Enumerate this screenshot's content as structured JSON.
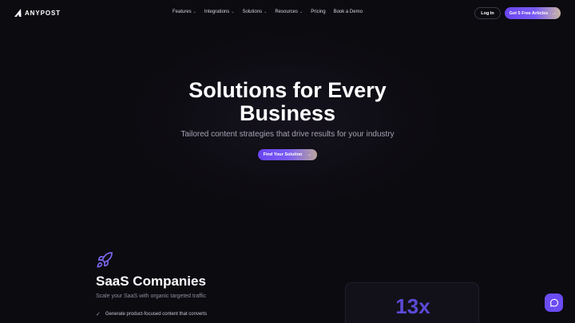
{
  "brand": {
    "name": "ANYPOST"
  },
  "nav": {
    "items": [
      {
        "label": "Features",
        "has_dropdown": true
      },
      {
        "label": "Integrations",
        "has_dropdown": true
      },
      {
        "label": "Solutions",
        "has_dropdown": true
      },
      {
        "label": "Resources",
        "has_dropdown": true
      },
      {
        "label": "Pricing",
        "has_dropdown": false
      },
      {
        "label": "Book a Demo",
        "has_dropdown": false
      }
    ],
    "login_label": "Log In",
    "cta_label": "Get 5 Free Articles",
    "cta_arrow": "→"
  },
  "hero": {
    "title_line1": "Solutions for Every",
    "title_line2": "Business",
    "subtitle": "Tailored content strategies that drive results for your industry",
    "button_label": "Find Your Solution",
    "button_arrow": "→"
  },
  "section": {
    "icon": "rocket-icon",
    "title": "SaaS Companies",
    "subtitle": "Scale your SaaS with organic targeted traffic",
    "bullets": [
      "Generate product-focused content that converts"
    ],
    "check_glyph": "✓"
  },
  "stat": {
    "value": "13x"
  },
  "colors": {
    "background": "#0c0b10",
    "accent": "#6a45f0",
    "stat_text": "#5b4ad6",
    "muted_text": "#a6a3b3"
  }
}
